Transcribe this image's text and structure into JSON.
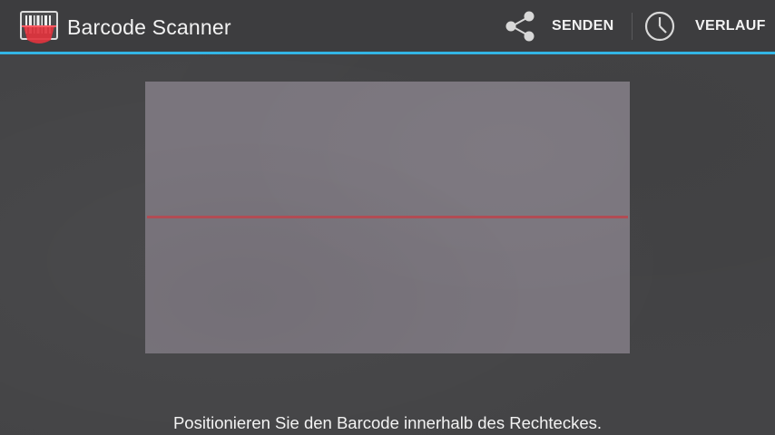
{
  "action_bar": {
    "title": "Barcode Scanner",
    "app_icon": "barcode-scanner-icon",
    "accent_color": "#33b5e5",
    "actions": [
      {
        "label": "SENDEN",
        "icon": "share-icon"
      },
      {
        "label": "VERLAUF",
        "icon": "clock-icon"
      }
    ]
  },
  "viewfinder": {
    "laser_color": "#b44a52"
  },
  "status_text": "Positionieren Sie den Barcode innerhalb des Rechteckes."
}
